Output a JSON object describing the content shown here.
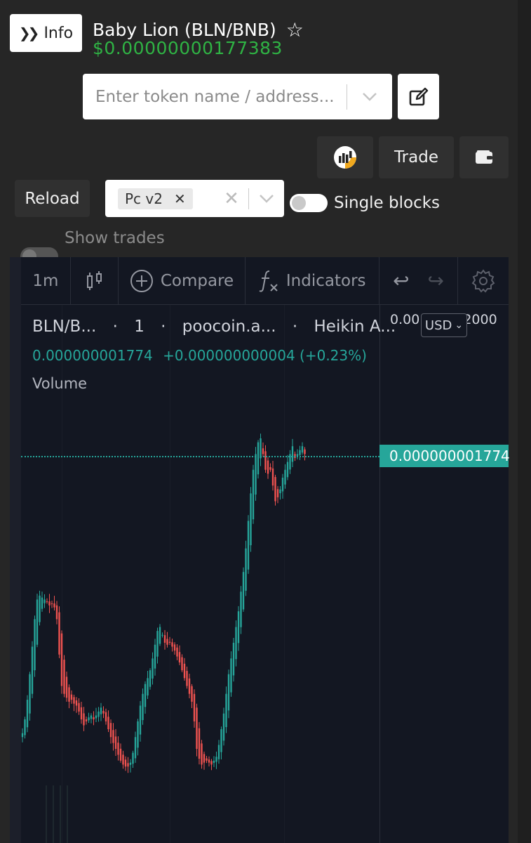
{
  "header": {
    "info_label": "Info",
    "token_title": "Baby Lion (BLN/BNB)",
    "price": "$0.00000000177383"
  },
  "search": {
    "placeholder": "Enter token name / address..."
  },
  "actions": {
    "trade_label": "Trade",
    "reload_label": "Reload"
  },
  "router_select": {
    "selected": "Pc v2"
  },
  "toggles": {
    "single_blocks_label": "Single blocks",
    "single_blocks_on": false,
    "show_trades_label": "Show trades",
    "show_trades_on": false
  },
  "chart_toolbar": {
    "interval": "1m",
    "compare_label": "Compare",
    "indicators_label": "Indicators"
  },
  "legend": {
    "symbol": "BLN/B...",
    "interval": "1",
    "source": "poocoin.a...",
    "style": "Heikin A...",
    "last_value": "0.000000001774",
    "change": "+0.000000000004 (+0.23%)",
    "volume_label": "Volume"
  },
  "price_axis": {
    "top_left": "0.00",
    "top_right": "2000",
    "currency": "USD",
    "last_price_tag": "0.000000001774"
  },
  "colors": {
    "up": "#26a69a",
    "down": "#ef5350",
    "price_green": "#2fb344",
    "chart_bg": "#131722"
  },
  "chart_data": {
    "type": "candlestick",
    "style": "Heikin Ashi",
    "series_name": "",
    "x": [
      0,
      1,
      2,
      3,
      4,
      5,
      6,
      7,
      8,
      9,
      10,
      11,
      12,
      13,
      14,
      15,
      16,
      17,
      18,
      19,
      20,
      21,
      22,
      23,
      24,
      25,
      26,
      27,
      28,
      29,
      30,
      31,
      32,
      33,
      34,
      35,
      36,
      37,
      38,
      39,
      40,
      41,
      42,
      43,
      44,
      45,
      46,
      47,
      48,
      49,
      50,
      51,
      52,
      53,
      54,
      55,
      56,
      57,
      58,
      59,
      60,
      61,
      62,
      63,
      64,
      65,
      66,
      67,
      68,
      69,
      70,
      71,
      72,
      73,
      74,
      75,
      76,
      77,
      78,
      79,
      80,
      81,
      82,
      83,
      84,
      85,
      86,
      87,
      88,
      89,
      90,
      91,
      92,
      93,
      94,
      95,
      96,
      97,
      98,
      99,
      100,
      101,
      102,
      103,
      104,
      105,
      106,
      107,
      108,
      109,
      110,
      111,
      112,
      113,
      114,
      115,
      116,
      117,
      118,
      119,
      120,
      121,
      122,
      123,
      124,
      125,
      126,
      127,
      128,
      129,
      130,
      131,
      132,
      133,
      134,
      135,
      136,
      137,
      138,
      139,
      140,
      141,
      142,
      143,
      144,
      145,
      146,
      147,
      148,
      149,
      150,
      151,
      152,
      153,
      154,
      155,
      156,
      157,
      158,
      159,
      160,
      161,
      162,
      163,
      164,
      165,
      166,
      167,
      168,
      169,
      170,
      171,
      172,
      173,
      174,
      175,
      176,
      177,
      178,
      179,
      180,
      181,
      182,
      183,
      184,
      185,
      186,
      187,
      188,
      189,
      190,
      191,
      192,
      193,
      194,
      195,
      196,
      197,
      198,
      199
    ],
    "close_approx": [
      0.38,
      0.45,
      0.55,
      0.68,
      0.82,
      0.96,
      1.06,
      1.08,
      1.07,
      1.06,
      1.05,
      1.03,
      1.04,
      1.02,
      0.96,
      0.78,
      0.62,
      0.58,
      0.56,
      0.54,
      0.55,
      0.53,
      0.52,
      0.49,
      0.45,
      0.42,
      0.44,
      0.46,
      0.47,
      0.45,
      0.47,
      0.49,
      0.51,
      0.48,
      0.44,
      0.4,
      0.36,
      0.33,
      0.3,
      0.27,
      0.24,
      0.22,
      0.21,
      0.21,
      0.23,
      0.28,
      0.36,
      0.44,
      0.52,
      0.58,
      0.63,
      0.66,
      0.7,
      0.76,
      0.83,
      0.9,
      0.92,
      0.88,
      0.84,
      0.83,
      0.84,
      0.82,
      0.8,
      0.77,
      0.74,
      0.7,
      0.66,
      0.62,
      0.58,
      0.54,
      0.44,
      0.3,
      0.25,
      0.22,
      0.23,
      0.24,
      0.23,
      0.22,
      0.24,
      0.26,
      0.32,
      0.4,
      0.48,
      0.58,
      0.68,
      0.76,
      0.84,
      0.92,
      1.0,
      1.1,
      1.2,
      1.32,
      1.46,
      1.6,
      1.72,
      1.8,
      1.86,
      1.88,
      1.8,
      1.72,
      1.7,
      1.72,
      1.64,
      1.56,
      1.58,
      1.62,
      1.68,
      1.72,
      1.76,
      1.8,
      1.84,
      1.78,
      1.8,
      1.82,
      1.84,
      1.8
    ],
    "last_price": "0.000000001774",
    "y_axis_currency": "USD",
    "grid": true
  }
}
